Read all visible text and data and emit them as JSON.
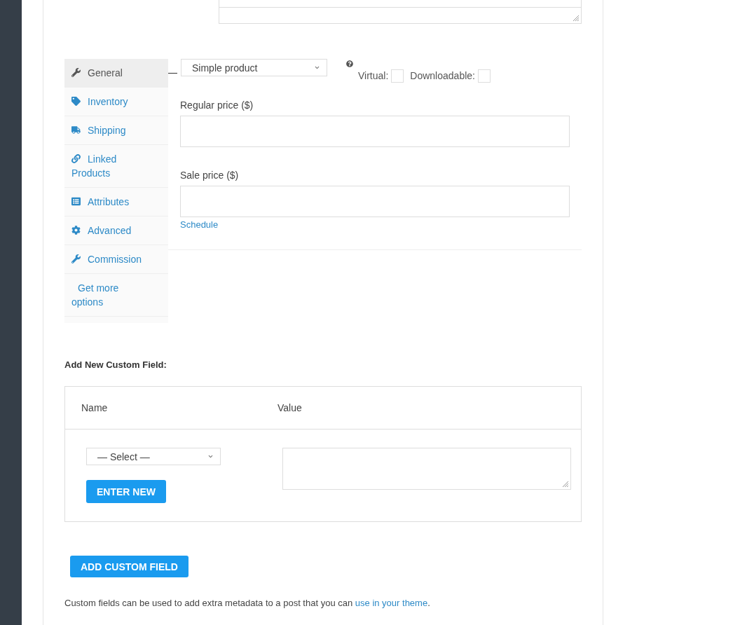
{
  "product_data": {
    "tabs": [
      {
        "label": "General",
        "kind": "general",
        "selected": true
      },
      {
        "label": "Inventory",
        "kind": "inventory",
        "selected": false
      },
      {
        "label": "Shipping",
        "kind": "shipping",
        "selected": false
      },
      {
        "label": "Linked Products",
        "kind": "linked",
        "selected": false
      },
      {
        "label": "Attributes",
        "kind": "attributes",
        "selected": false
      },
      {
        "label": "Advanced",
        "kind": "advanced",
        "selected": false
      },
      {
        "label": "Commission",
        "kind": "commission",
        "selected": false
      },
      {
        "label": "Get more options",
        "kind": "more",
        "selected": false
      }
    ],
    "product_type": "Simple product",
    "options": [
      {
        "label": "Virtual:",
        "checked": false
      },
      {
        "label": "Downloadable:",
        "checked": false
      }
    ],
    "fields": [
      {
        "label": "Regular price ($)"
      },
      {
        "label": "Sale price ($)"
      }
    ],
    "schedule_link": "Schedule"
  },
  "custom_fields": {
    "title": "Add New Custom Field:",
    "columns": [
      "Name",
      "Value"
    ],
    "name_select": "— Select —",
    "enter_new_button": "ENTER NEW",
    "add_button": "ADD CUSTOM FIELD",
    "note": {
      "before": "Custom fields can be used to add extra metadata to a post that you can ",
      "link": "use in your theme",
      "after": "."
    }
  }
}
